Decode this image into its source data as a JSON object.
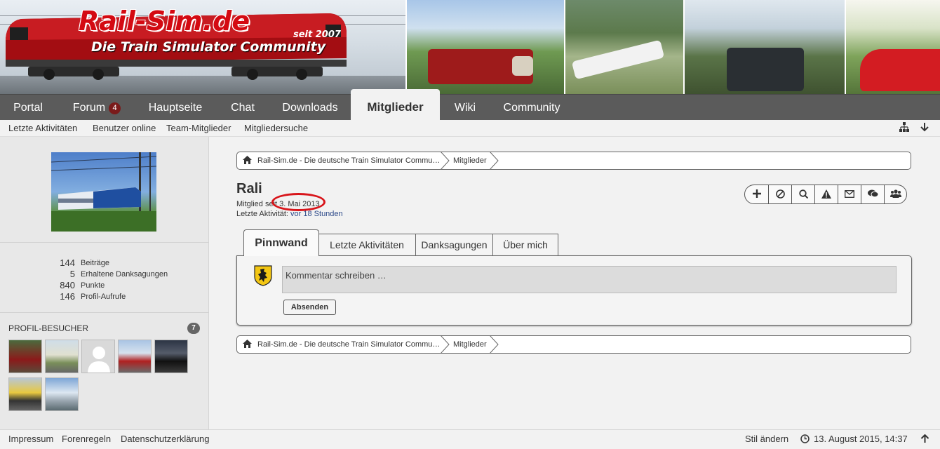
{
  "header": {
    "logo_title": "Rail-Sim.de",
    "logo_subtitle": "Die Train Simulator Community",
    "logo_since": "seit 2007"
  },
  "nav": {
    "items": [
      {
        "label": "Portal"
      },
      {
        "label": "Forum",
        "badge": "4"
      },
      {
        "label": "Hauptseite"
      },
      {
        "label": "Chat"
      },
      {
        "label": "Downloads"
      },
      {
        "label": "Mitglieder",
        "active": true
      },
      {
        "label": "Wiki"
      },
      {
        "label": "Community"
      }
    ]
  },
  "subnav": {
    "items": [
      "Letzte Aktivitäten",
      "Benutzer online",
      "Team-Mitglieder",
      "Mitgliedersuche"
    ],
    "icons": [
      "sitemap-icon",
      "arrow-down-icon"
    ]
  },
  "sidebar": {
    "stats": [
      {
        "value": "144",
        "label": "Beiträge"
      },
      {
        "value": "5",
        "label": "Erhaltene Danksagungen"
      },
      {
        "value": "840",
        "label": "Punkte"
      },
      {
        "value": "146",
        "label": "Profil-Aufrufe"
      }
    ],
    "visitors_title": "PROFIL-BESUCHER",
    "visitors_count": "7"
  },
  "breadcrumb": {
    "items": [
      "Rail-Sim.de - Die deutsche Train Simulator Commu…",
      "Mitglieder"
    ]
  },
  "profile": {
    "username": "Rali",
    "member_since_label": "Mitglied seit",
    "member_since_value": "3. Mai 2013",
    "last_activity_label": "Letzte Aktivität:",
    "last_activity_value": "vor 18 Stunden"
  },
  "actions": {
    "icons": [
      "plus-icon",
      "block-icon",
      "search-icon",
      "warning-icon",
      "envelope-icon",
      "chat-icon",
      "group-icon"
    ]
  },
  "tabs": {
    "items": [
      {
        "label": "Pinnwand",
        "active": true
      },
      {
        "label": "Letzte Aktivitäten"
      },
      {
        "label": "Danksagungen"
      },
      {
        "label": "Über mich"
      }
    ]
  },
  "wall": {
    "comment_placeholder": "Kommentar schreiben …",
    "send_label": "Absenden"
  },
  "footer": {
    "links": [
      "Impressum",
      "Forenregeln",
      "Datenschutzerklärung"
    ],
    "style_label": "Stil ändern",
    "datetime": "13. August 2015, 14:37"
  },
  "colors": {
    "accent_red": "#d40a12",
    "nav_bg": "#5b5b5b",
    "link_blue": "#2d4a8a",
    "annotation_red": "#d8141a"
  }
}
